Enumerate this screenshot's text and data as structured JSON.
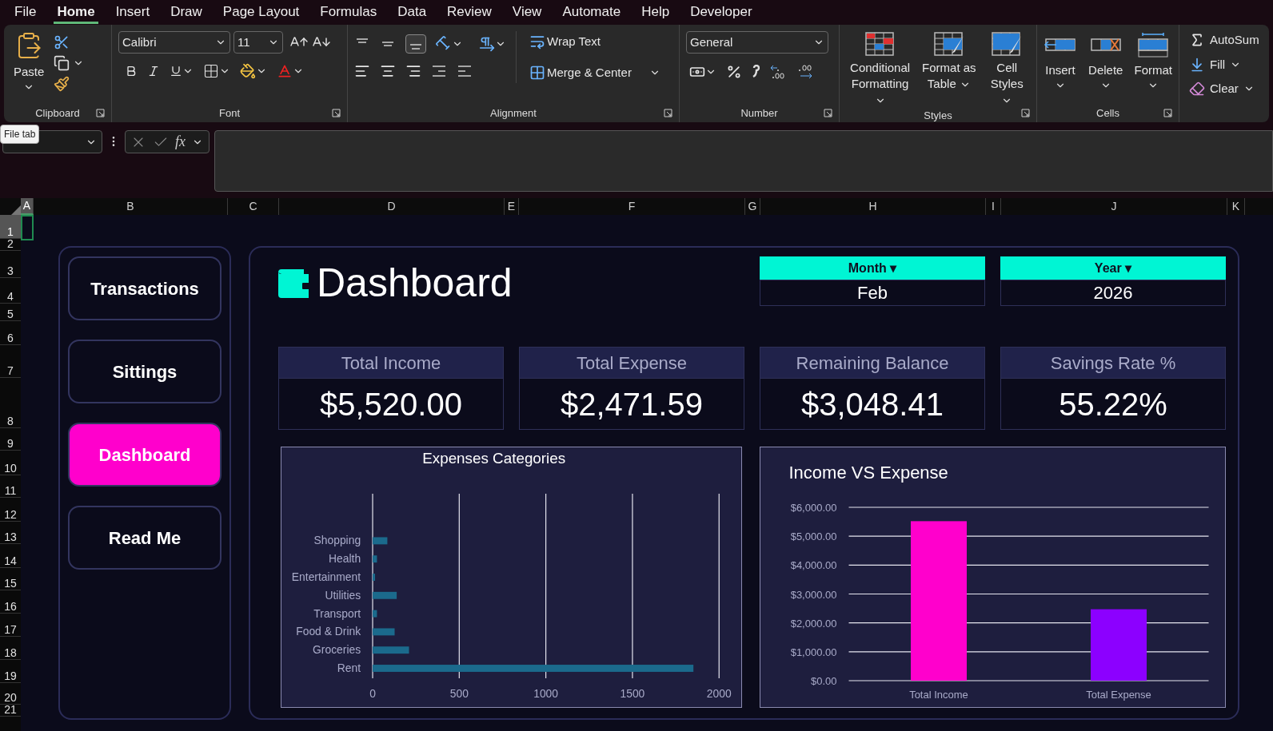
{
  "menu_tabs": [
    {
      "label": "File",
      "selected": false
    },
    {
      "label": "Home",
      "selected": true
    },
    {
      "label": "Insert",
      "selected": false
    },
    {
      "label": "Draw",
      "selected": false
    },
    {
      "label": "Page Layout",
      "selected": false
    },
    {
      "label": "Formulas",
      "selected": false
    },
    {
      "label": "Data",
      "selected": false
    },
    {
      "label": "Review",
      "selected": false
    },
    {
      "label": "View",
      "selected": false
    },
    {
      "label": "Automate",
      "selected": false
    },
    {
      "label": "Help",
      "selected": false
    },
    {
      "label": "Developer",
      "selected": false
    }
  ],
  "ribbon": {
    "clipboard": {
      "paste": "Paste",
      "label": "Clipboard"
    },
    "font": {
      "family": "Calibri",
      "size": "11",
      "label": "Font"
    },
    "alignment": {
      "wrap_text": "Wrap Text",
      "merge_center": "Merge & Center",
      "label": "Alignment"
    },
    "number": {
      "format": "General",
      "label": "Number"
    },
    "styles": {
      "buttons": [
        "Conditional Formatting",
        "Format as Table",
        "Cell Styles"
      ],
      "label": "Styles"
    },
    "cells": {
      "buttons": [
        "Insert",
        "Delete",
        "Format"
      ],
      "label": "Cells"
    },
    "editing": {
      "items": [
        "AutoSum",
        "Fill",
        "Clear"
      ]
    }
  },
  "tooltip": "File tab",
  "formula_bar": {
    "function_label": "fx"
  },
  "column_headers": [
    {
      "label": "A",
      "selected": true
    },
    {
      "label": "B",
      "selected": false
    },
    {
      "label": "C",
      "selected": false
    },
    {
      "label": "D",
      "selected": false
    },
    {
      "label": "E",
      "selected": false
    },
    {
      "label": "F",
      "selected": false
    },
    {
      "label": "G",
      "selected": false
    },
    {
      "label": "H",
      "selected": false
    },
    {
      "label": "I",
      "selected": false
    },
    {
      "label": "J",
      "selected": false
    },
    {
      "label": "K",
      "selected": false
    }
  ],
  "row_headers": [
    {
      "label": "1",
      "selected": true
    },
    {
      "label": "2",
      "selected": false
    },
    {
      "label": "3",
      "selected": false
    },
    {
      "label": "4",
      "selected": false
    },
    {
      "label": "5",
      "selected": false
    },
    {
      "label": "6",
      "selected": false
    },
    {
      "label": "7",
      "selected": false
    },
    {
      "label": "8",
      "selected": false
    },
    {
      "label": "9",
      "selected": false
    },
    {
      "label": "10",
      "selected": false
    },
    {
      "label": "11",
      "selected": false
    },
    {
      "label": "12",
      "selected": false
    },
    {
      "label": "13",
      "selected": false
    },
    {
      "label": "14",
      "selected": false
    },
    {
      "label": "15",
      "selected": false
    },
    {
      "label": "16",
      "selected": false
    },
    {
      "label": "17",
      "selected": false
    },
    {
      "label": "18",
      "selected": false
    },
    {
      "label": "19",
      "selected": false
    },
    {
      "label": "20",
      "selected": false
    },
    {
      "label": "21",
      "selected": false
    }
  ],
  "sidebar": [
    {
      "label": "Transactions",
      "selected": false
    },
    {
      "label": "Sittings",
      "selected": false
    },
    {
      "label": "Dashboard",
      "selected": true
    },
    {
      "label": "Read Me",
      "selected": false
    }
  ],
  "dashboard": {
    "title": "Dashboard",
    "filters": [
      {
        "label": "Month ▾",
        "value": "Feb"
      },
      {
        "label": "Year ▾",
        "value": "2026"
      }
    ],
    "kpis": [
      {
        "label": "Total Income",
        "value": "$5,520.00"
      },
      {
        "label": "Total Expense",
        "value": "$2,471.59"
      },
      {
        "label": "Remaining Balance",
        "value": "$3,048.41"
      },
      {
        "label": "Savings Rate %",
        "value": "55.22%"
      }
    ],
    "charts": [
      {
        "chart_data": {
          "type": "bar",
          "orientation": "horizontal",
          "title": "Expenses Categories",
          "categories": [
            "Shopping",
            "Health",
            "Entertainment",
            "Utilities",
            "Transport",
            "Food & Drink",
            "Groceries",
            "Rent"
          ],
          "series": [
            {
              "color": "#1b6a8c",
              "values": [
                85,
                25,
                14,
                139,
                25,
                127,
                210,
                1852
              ]
            }
          ],
          "xlim": [
            0,
            2000
          ],
          "xticks": [
            0,
            500,
            1000,
            1500,
            2000
          ],
          "grid": true
        }
      },
      {
        "chart_data": {
          "type": "bar",
          "title": "Income VS Expense",
          "categories": [
            "Total Income",
            "Total Expense"
          ],
          "series": [
            {
              "color": "#ff00cc",
              "values": [
                5520,
                null
              ]
            },
            {
              "color": "#8c00ff",
              "values": [
                null,
                2472
              ]
            }
          ],
          "stacked": true,
          "grid": true,
          "ylim": [
            0,
            6000
          ],
          "yticks": [
            {
              "value": 0,
              "label": "$0.00"
            },
            {
              "value": 1000,
              "label": "$1,000.00"
            },
            {
              "value": 2000,
              "label": "$2,000.00"
            },
            {
              "value": 3000,
              "label": "$3,000.00"
            },
            {
              "value": 4000,
              "label": "$4,000.00"
            },
            {
              "value": 5000,
              "label": "$5,000.00"
            },
            {
              "value": 6000,
              "label": "$6,000.00"
            }
          ]
        }
      }
    ]
  }
}
